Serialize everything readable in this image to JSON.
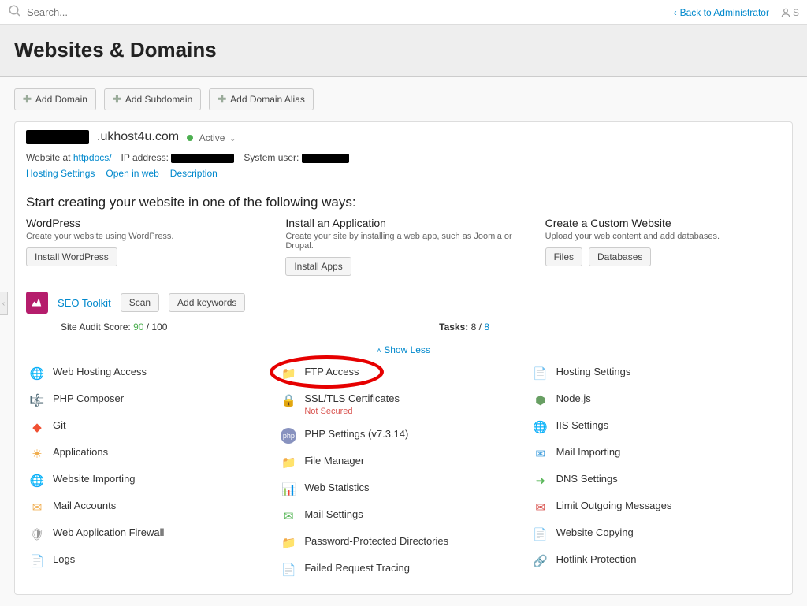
{
  "topbar": {
    "search_placeholder": "Search...",
    "back_link": "Back to Administrator",
    "user_letter": "S"
  },
  "page_title": "Websites & Domains",
  "domain_buttons": {
    "add_domain": "Add Domain",
    "add_subdomain": "Add Subdomain",
    "add_alias": "Add Domain Alias"
  },
  "domain": {
    "name_suffix": ".ukhost4u.com",
    "status": "Active",
    "website_at_label": "Website at",
    "website_at_link": "httpdocs/",
    "ip_label": "IP address:",
    "sysuser_label": "System user:",
    "links": {
      "hosting_settings": "Hosting Settings",
      "open_web": "Open in web",
      "description": "Description"
    }
  },
  "create_title": "Start creating your website in one of the following ways:",
  "create_options": {
    "wp": {
      "title": "WordPress",
      "desc": "Create your website using WordPress.",
      "btn": "Install WordPress"
    },
    "app": {
      "title": "Install an Application",
      "desc": "Create your site by installing a web app, such as Joomla or Drupal.",
      "btn": "Install Apps"
    },
    "custom": {
      "title": "Create a Custom Website",
      "desc": "Upload your web content and add databases.",
      "btn1": "Files",
      "btn2": "Databases"
    }
  },
  "seo": {
    "label": "SEO Toolkit",
    "scan": "Scan",
    "addkw": "Add keywords",
    "score_label": "Site Audit Score:",
    "score": "90",
    "score_total": " / 100",
    "tasks_label": "Tasks:",
    "tasks_done": "8 / ",
    "tasks_total": "8"
  },
  "show_less": "Show Less",
  "grid": {
    "col1": [
      {
        "id": "web-hosting-access",
        "label": "Web Hosting Access",
        "icon": "🌐",
        "color": "#4aa3df"
      },
      {
        "id": "php-composer",
        "label": "PHP Composer",
        "icon": "🎼",
        "color": "#8b6f47"
      },
      {
        "id": "git",
        "label": "Git",
        "icon": "◆",
        "color": "#f05033"
      },
      {
        "id": "applications",
        "label": "Applications",
        "icon": "☀",
        "color": "#f0ad4e"
      },
      {
        "id": "website-importing",
        "label": "Website Importing",
        "icon": "🌐",
        "color": "#4aa3df"
      },
      {
        "id": "mail-accounts",
        "label": "Mail Accounts",
        "icon": "✉",
        "color": "#f0ad4e"
      },
      {
        "id": "web-app-firewall",
        "label": "Web Application Firewall",
        "icon": "🛡",
        "color": "#999"
      },
      {
        "id": "logs",
        "label": "Logs",
        "icon": "📄",
        "color": "#d4b896"
      }
    ],
    "col2": [
      {
        "id": "ftp-access",
        "label": "FTP Access",
        "icon": "📁",
        "color": "#4aa3df",
        "circled": true
      },
      {
        "id": "ssl-certs",
        "label": "SSL/TLS Certificates",
        "sub": "Not Secured",
        "icon": "🔒",
        "color": "#f0ad4e"
      },
      {
        "id": "php-settings",
        "label": "PHP Settings (v7.3.14)",
        "icon": "⬤",
        "color": "#8892bf",
        "iconText": "php"
      },
      {
        "id": "file-manager",
        "label": "File Manager",
        "icon": "📁",
        "color": "#e8922a"
      },
      {
        "id": "web-statistics",
        "label": "Web Statistics",
        "icon": "📊",
        "color": "#d9534f"
      },
      {
        "id": "mail-settings",
        "label": "Mail Settings",
        "icon": "✉",
        "color": "#5cb85c"
      },
      {
        "id": "password-protected",
        "label": "Password-Protected Directories",
        "icon": "📁",
        "color": "#e8922a"
      },
      {
        "id": "failed-request",
        "label": "Failed Request Tracing",
        "icon": "📄",
        "color": "#f0ad4e"
      }
    ],
    "col3": [
      {
        "id": "hosting-settings-item",
        "label": "Hosting Settings",
        "icon": "📄",
        "color": "#f0ad4e"
      },
      {
        "id": "nodejs",
        "label": "Node.js",
        "icon": "⬢",
        "color": "#689f63"
      },
      {
        "id": "iis-settings",
        "label": "IIS Settings",
        "icon": "🌐",
        "color": "#4aa3df"
      },
      {
        "id": "mail-importing",
        "label": "Mail Importing",
        "icon": "✉",
        "color": "#4aa3df"
      },
      {
        "id": "dns-settings",
        "label": "DNS Settings",
        "icon": "➜",
        "color": "#5cb85c"
      },
      {
        "id": "limit-outgoing",
        "label": "Limit Outgoing Messages",
        "icon": "✉",
        "color": "#d9534f"
      },
      {
        "id": "website-copying",
        "label": "Website Copying",
        "icon": "📄",
        "color": "#4aa3df"
      },
      {
        "id": "hotlink-protection",
        "label": "Hotlink Protection",
        "icon": "🔗",
        "color": "#999"
      }
    ]
  }
}
